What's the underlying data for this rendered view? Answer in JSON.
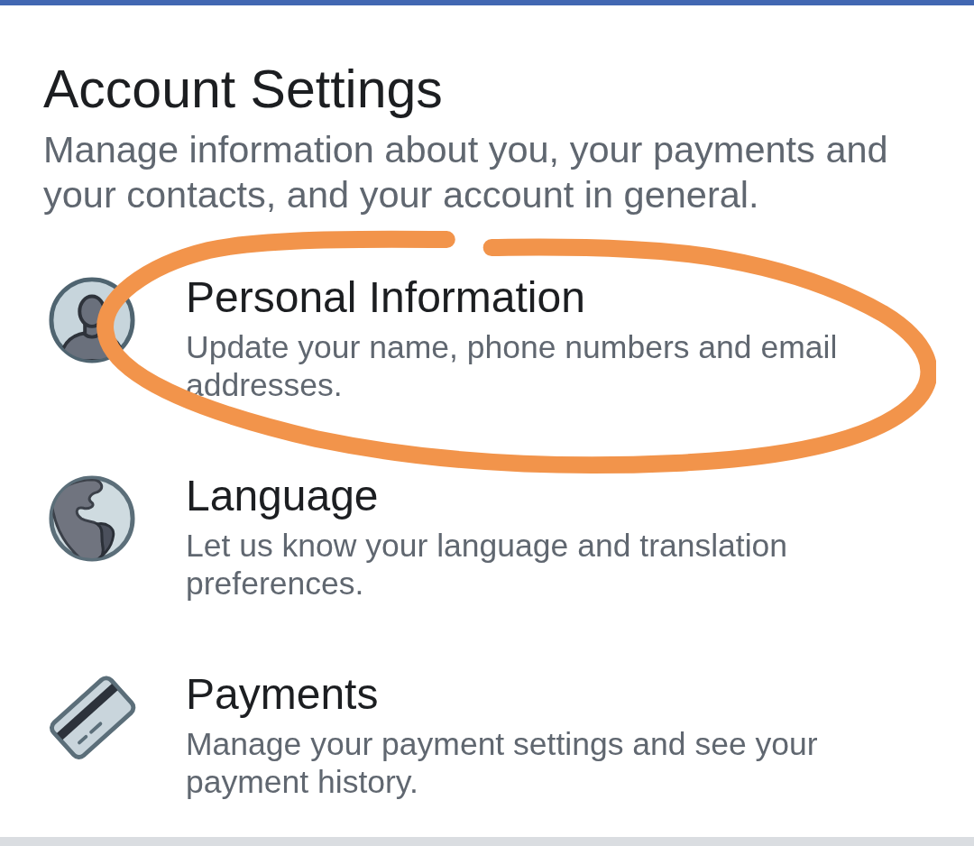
{
  "header": {
    "title": "Account Settings",
    "subtitle": "Manage information about you, your payments and your contacts, and your account in general."
  },
  "items": [
    {
      "title": "Personal Information",
      "description": "Update your name, phone numbers and email addresses.",
      "circled": true
    },
    {
      "title": "Language",
      "description": "Let us know your language and translation preferences.",
      "circled": false
    },
    {
      "title": "Payments",
      "description": "Manage your payment settings and see your payment history.",
      "circled": false
    }
  ]
}
